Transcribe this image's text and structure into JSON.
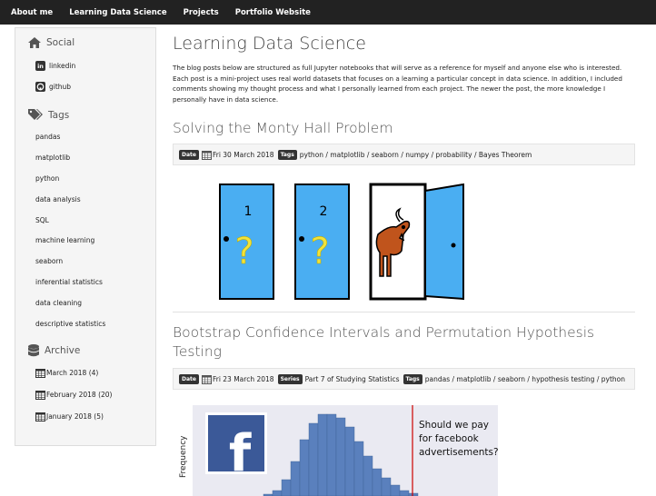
{
  "nav": {
    "items": [
      "About me",
      "Learning Data Science",
      "Projects",
      "Portfolio Website"
    ]
  },
  "sidebar": {
    "social_heading": "Social",
    "social_links": [
      {
        "label": "linkedin",
        "icon": "linkedin-icon"
      },
      {
        "label": "github",
        "icon": "github-icon"
      }
    ],
    "tags_heading": "Tags",
    "tags": [
      "pandas",
      "matplotlib",
      "python",
      "data analysis",
      "SQL",
      "machine learning",
      "seaborn",
      "inferential statistics",
      "data cleaning",
      "descriptive statistics"
    ],
    "archive_heading": "Archive",
    "archive": [
      "March 2018 (4)",
      "February 2018 (20)",
      "January 2018 (5)"
    ]
  },
  "main": {
    "title": "Learning Data Science",
    "intro": "The blog posts below are structured as full Jupyter notebooks that will serve as a reference for myself and anyone else who is interested. Each post is a mini-project uses real world datasets that focuses on a learning a particular concept in data science. In addition, I included comments showing my thought process and what I personally learned from each project. The newer the post, the more knowledge I personally have in data science.",
    "posts": [
      {
        "title": "Solving the Monty Hall Problem",
        "date_label": "Date",
        "date": "Fri 30 March 2018",
        "tags_label": "Tags",
        "tags": "python / matplotlib / seaborn / numpy / probability / Bayes Theorem",
        "image": {
          "door1": "1",
          "door2": "2"
        }
      },
      {
        "title_line1": "Bootstrap Confidence Intervals and Permutation Hypothesis",
        "title_line2": "Testing",
        "date_label": "Date",
        "date": "Fri 23 March 2018",
        "series_label": "Series",
        "series": "Part 7 of Studying Statistics",
        "tags_label": "Tags",
        "tags": "pandas / matplotlib / seaborn / hypothesis testing / python",
        "image": {
          "ylabel": "Frequency",
          "annotation_line1": "Should we pay",
          "annotation_line2": "for facebook",
          "annotation_line3": "advertisements?",
          "logo_letter": "f"
        }
      }
    ]
  },
  "colors": {
    "nav_bg": "#222222",
    "sidebar_bg": "#f5f5f5",
    "door_blue": "#3aa0ef",
    "hist_blue": "#4c72b0",
    "fb_blue": "#3b5998",
    "threshold_red": "#cc0000"
  }
}
